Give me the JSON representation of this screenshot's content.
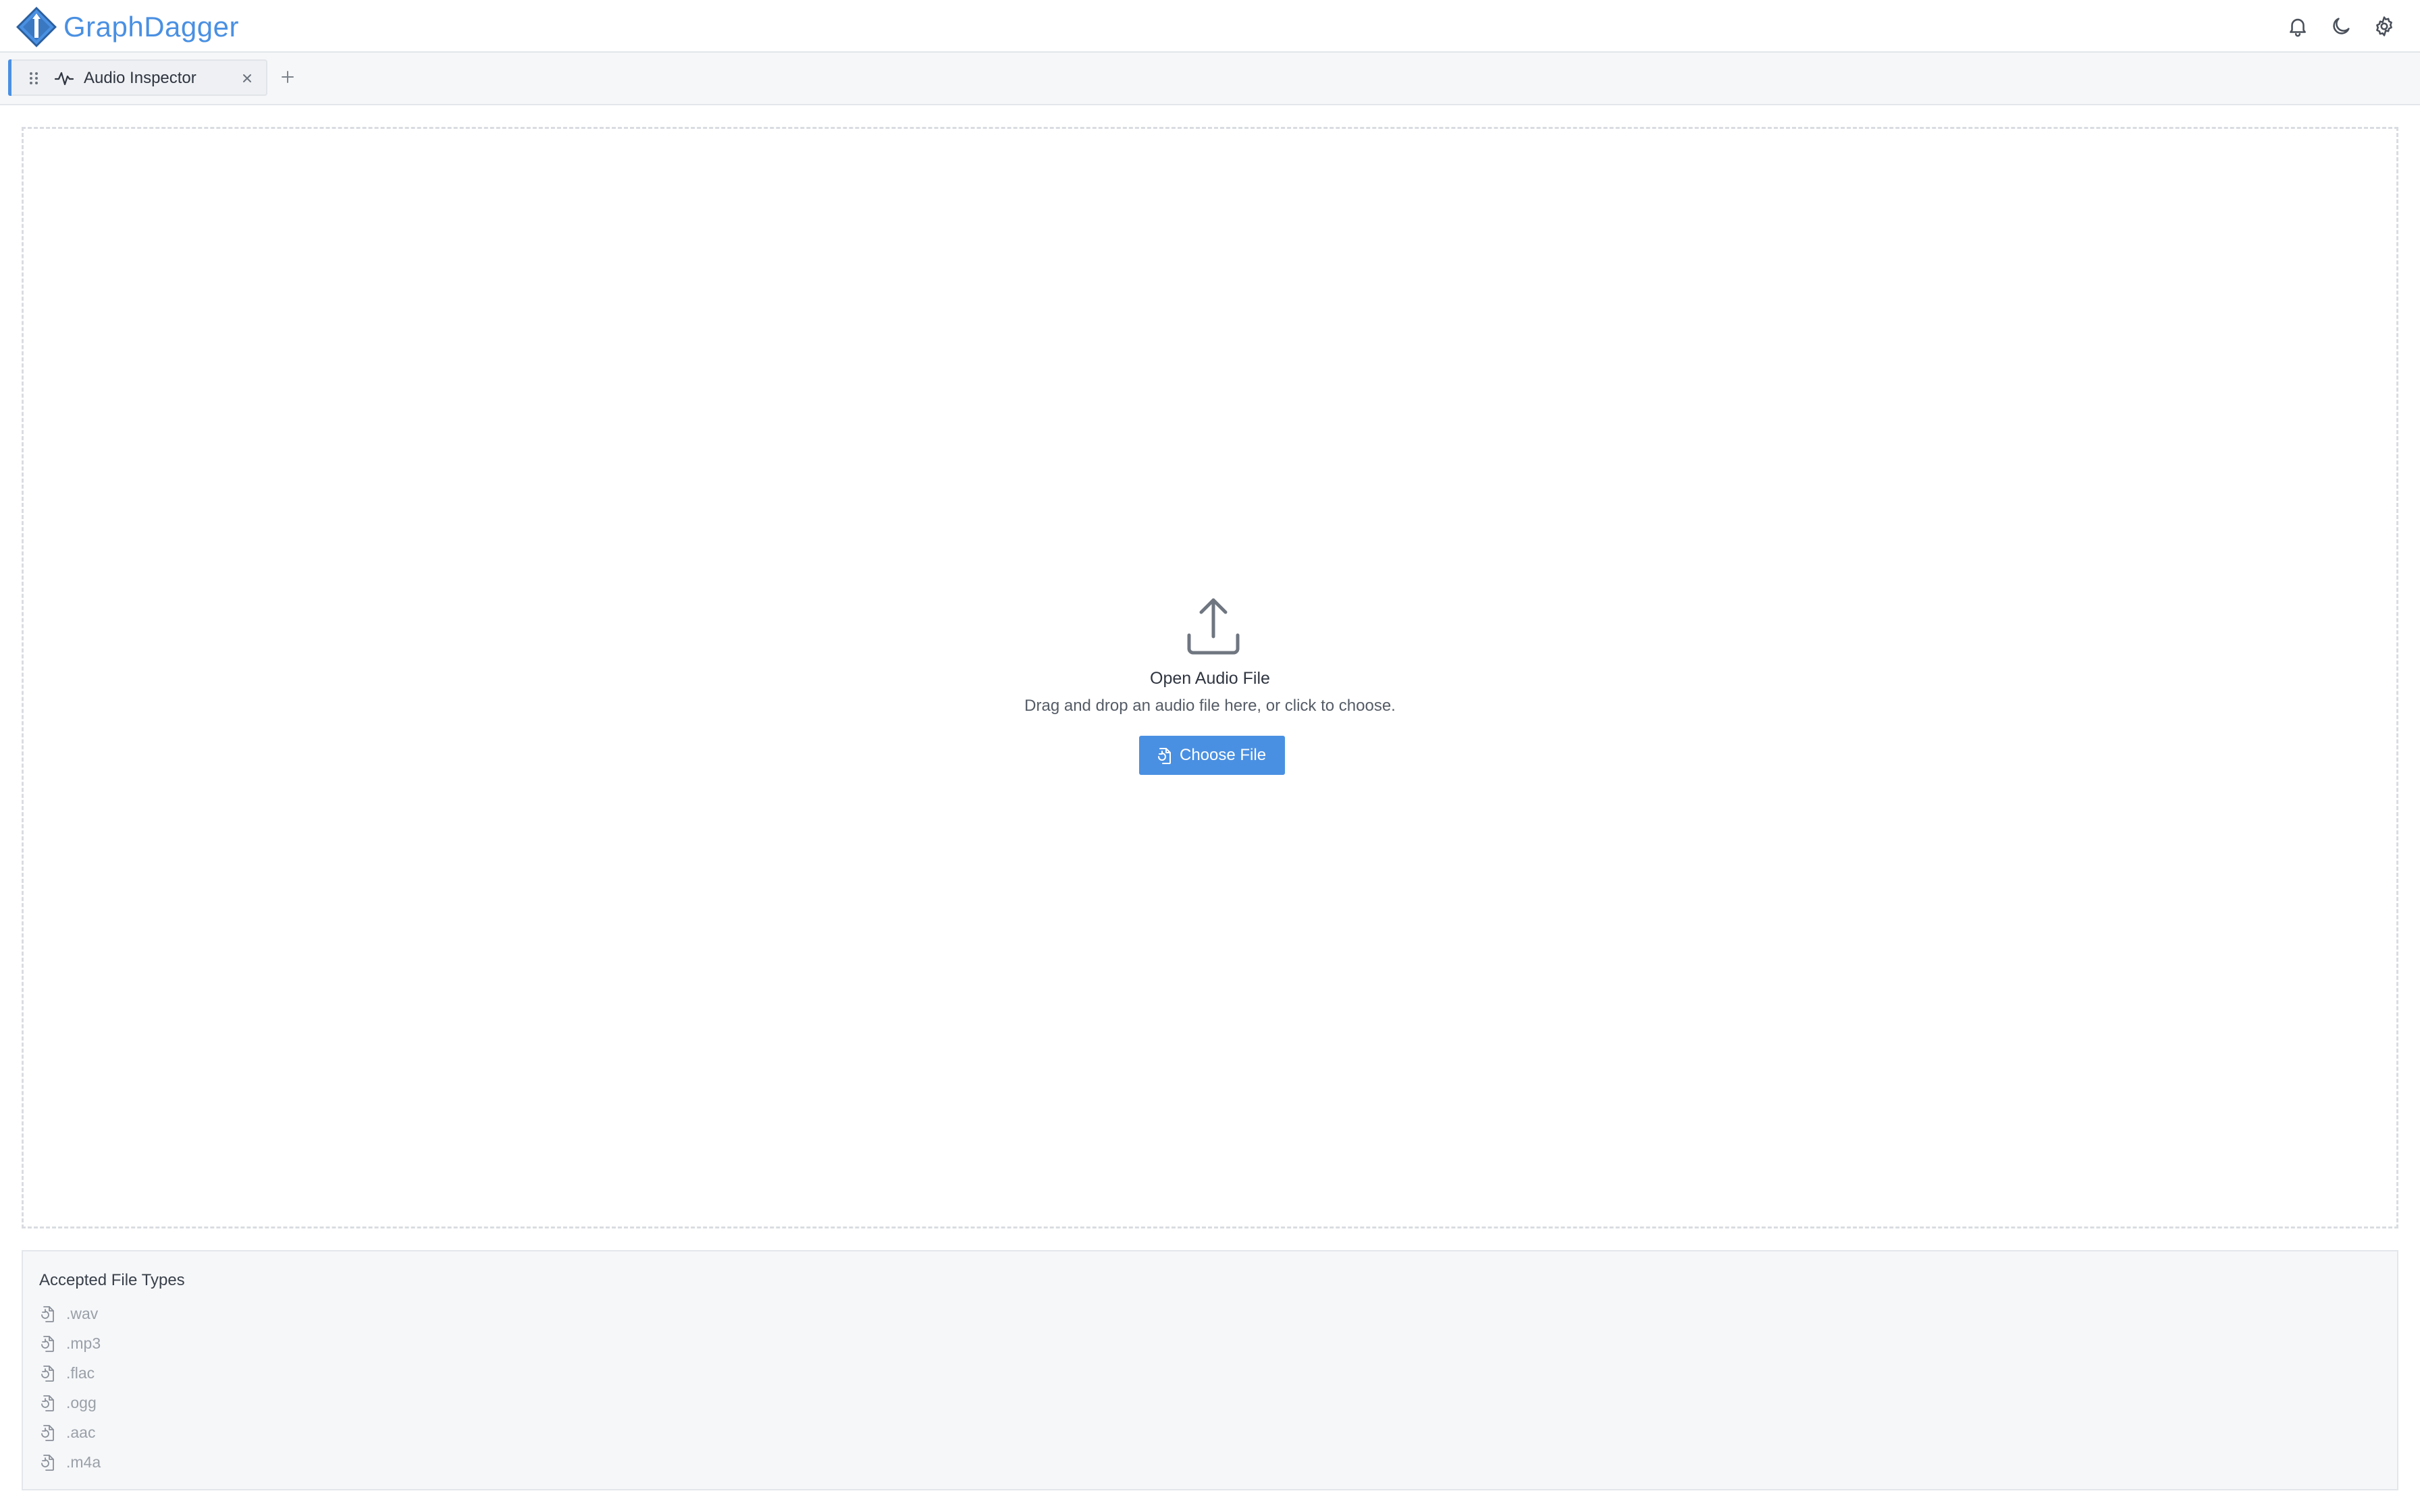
{
  "app": {
    "brand": "GraphDagger",
    "accent_color": "#4a90e2"
  },
  "header": {
    "icons": [
      "bell-icon",
      "moon-icon",
      "gear-icon"
    ]
  },
  "tabs": [
    {
      "label": "Audio Inspector",
      "icon": "waveform-icon",
      "active": true
    }
  ],
  "dropzone": {
    "title": "Open Audio File",
    "subtitle": "Drag and drop an audio file here, or click to choose.",
    "button_label": "Choose File"
  },
  "accepted": {
    "title": "Accepted File Types",
    "types": [
      ".wav",
      ".mp3",
      ".flac",
      ".ogg",
      ".aac",
      ".m4a"
    ]
  }
}
